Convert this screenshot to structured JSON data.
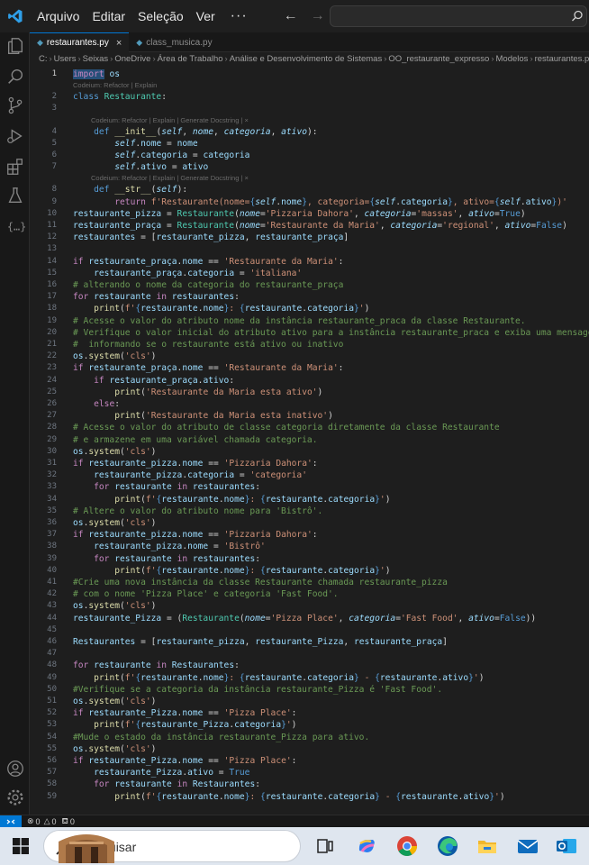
{
  "menu": {
    "items": [
      "Arquivo",
      "Editar",
      "Seleção",
      "Ver"
    ],
    "more": "···"
  },
  "tabs": [
    {
      "label": "restaurantes.py",
      "active": true
    },
    {
      "label": "class_musica.py",
      "active": false
    }
  ],
  "breadcrumb": [
    "C:",
    "Users",
    "Seixas",
    "OneDrive",
    "Área de Trabalho",
    "Análise e Desenvolvimento de Sistemas",
    "OO_restaurante_expresso",
    "Modelos",
    "restaurantes.py"
  ],
  "hints": {
    "refactor_explain": "Codeium: Refactor | Explain",
    "refactor_explain_docstring": "Codeium: Refactor | Explain | Generate Docstring | ×"
  },
  "code_lines": [
    "import os",
    "class Restaurante:",
    "",
    "    def __init__(self, nome, categoria, ativo):",
    "        self.nome = nome",
    "        self.categoria = categoria",
    "        self.ativo = ativo",
    "    def __str__(self):",
    "        return f'Restaurante(nome={self.nome}, categoria={self.categoria}, ativo={self.ativo})'",
    "restaurante_pizza = Restaurante(nome='Pizzaria Dahora', categoria='massas', ativo=True)",
    "restaurante_praça = Restaurante(nome='Restaurante da Maria', categoria='regional', ativo=False)",
    "restaurantes = [restaurante_pizza, restaurante_praça]",
    "",
    "if restaurante_praça.nome == 'Restaurante da Maria':",
    "    restaurante_praça.categoria = 'italiana'",
    "# alterando o nome da categoria do restaurante_praça",
    "for restaurante in restaurantes:",
    "    print(f'{restaurante.nome}: {restaurante.categoria}')",
    "# Acesse o valor do atributo nome da instância restaurante_praca da classe Restaurante.",
    "# Verifique o valor inicial do atributo ativo para a instância restaurante_praca e exiba uma mensagem",
    "#  informando se o restaurante está ativo ou inativo",
    "os.system('cls')",
    "if restaurante_praça.nome == 'Restaurante da Maria':",
    "    if restaurante_praça.ativo:",
    "        print('Restaurante da Maria esta ativo')",
    "    else:",
    "        print('Restaurante da Maria esta inativo')",
    "# Acesse o valor do atributo de classe categoria diretamente da classe Restaurante",
    "# e armazene em uma variável chamada categoria.",
    "os.system('cls')",
    "if restaurante_pizza.nome == 'Pizzaria Dahora':",
    "    restaurante_pizza.categoria = 'categoria'",
    "    for restaurante in restaurantes:",
    "        print(f'{restaurante.nome}: {restaurante.categoria}')",
    "# Altere o valor do atributo nome para 'Bistrô'.",
    "os.system('cls')",
    "if restaurante_pizza.nome == 'Pizzaria Dahora':",
    "    restaurante_pizza.nome = 'Bistrô'",
    "    for restaurante in restaurantes:",
    "        print(f'{restaurante.nome}: {restaurante.categoria}')",
    "#Crie uma nova instância da classe Restaurante chamada restaurante_pizza",
    "# com o nome 'Pizza Place' e categoria 'Fast Food'.",
    "os.system('cls')",
    "restaurante_Pizza = (Restaurante(nome='Pizza Place', categoria='Fast Food', ativo=False))",
    "",
    "Restaurantes = [restaurante_pizza, restaurante_Pizza, restaurante_praça]",
    "",
    "for restaurante in Restaurantes:",
    "    print(f'{restaurante.nome}: {restaurante.categoria} - {restaurante.ativo}')",
    "#Verifique se a categoria da instância restaurante_Pizza é 'Fast Food'.",
    "os.system('cls')",
    "if restaurante_Pizza.nome == 'Pizza Place':",
    "    print(f'{restaurante_Pizza.categoria}')",
    "#Mude o estado da instância restaurante_Pizza para ativo.",
    "os.system('cls')",
    "if restaurante_Pizza.nome == 'Pizza Place':",
    "    restaurante_Pizza.ativo = True",
    "    for restaurante in Restaurantes:",
    "        print(f'{restaurante.nome}: {restaurante.categoria} - {restaurante.ativo}')"
  ],
  "current_line": 1,
  "status": {
    "remote": "><",
    "errors": "0",
    "warnings": "0",
    "ports": "0"
  },
  "taskbar": {
    "search_placeholder": "Pesquisar"
  },
  "colors": {
    "editor_bg": "#1e1e1e",
    "keyword": "#c586c0",
    "class": "#4ec9b0",
    "string": "#ce9178",
    "comment": "#6a9955",
    "variable": "#9cdcfe",
    "accent": "#0078d4"
  },
  "icons": [
    "vscode-logo-icon",
    "explorer-icon",
    "search-icon",
    "source-control-icon",
    "run-debug-icon",
    "extensions-icon",
    "testing-icon",
    "json-braces-icon",
    "account-icon",
    "settings-gear-icon",
    "windows-start-icon",
    "task-view-icon",
    "copilot-icon",
    "chrome-icon",
    "edge-icon",
    "file-explorer-icon",
    "mail-icon",
    "outlook-icon"
  ]
}
